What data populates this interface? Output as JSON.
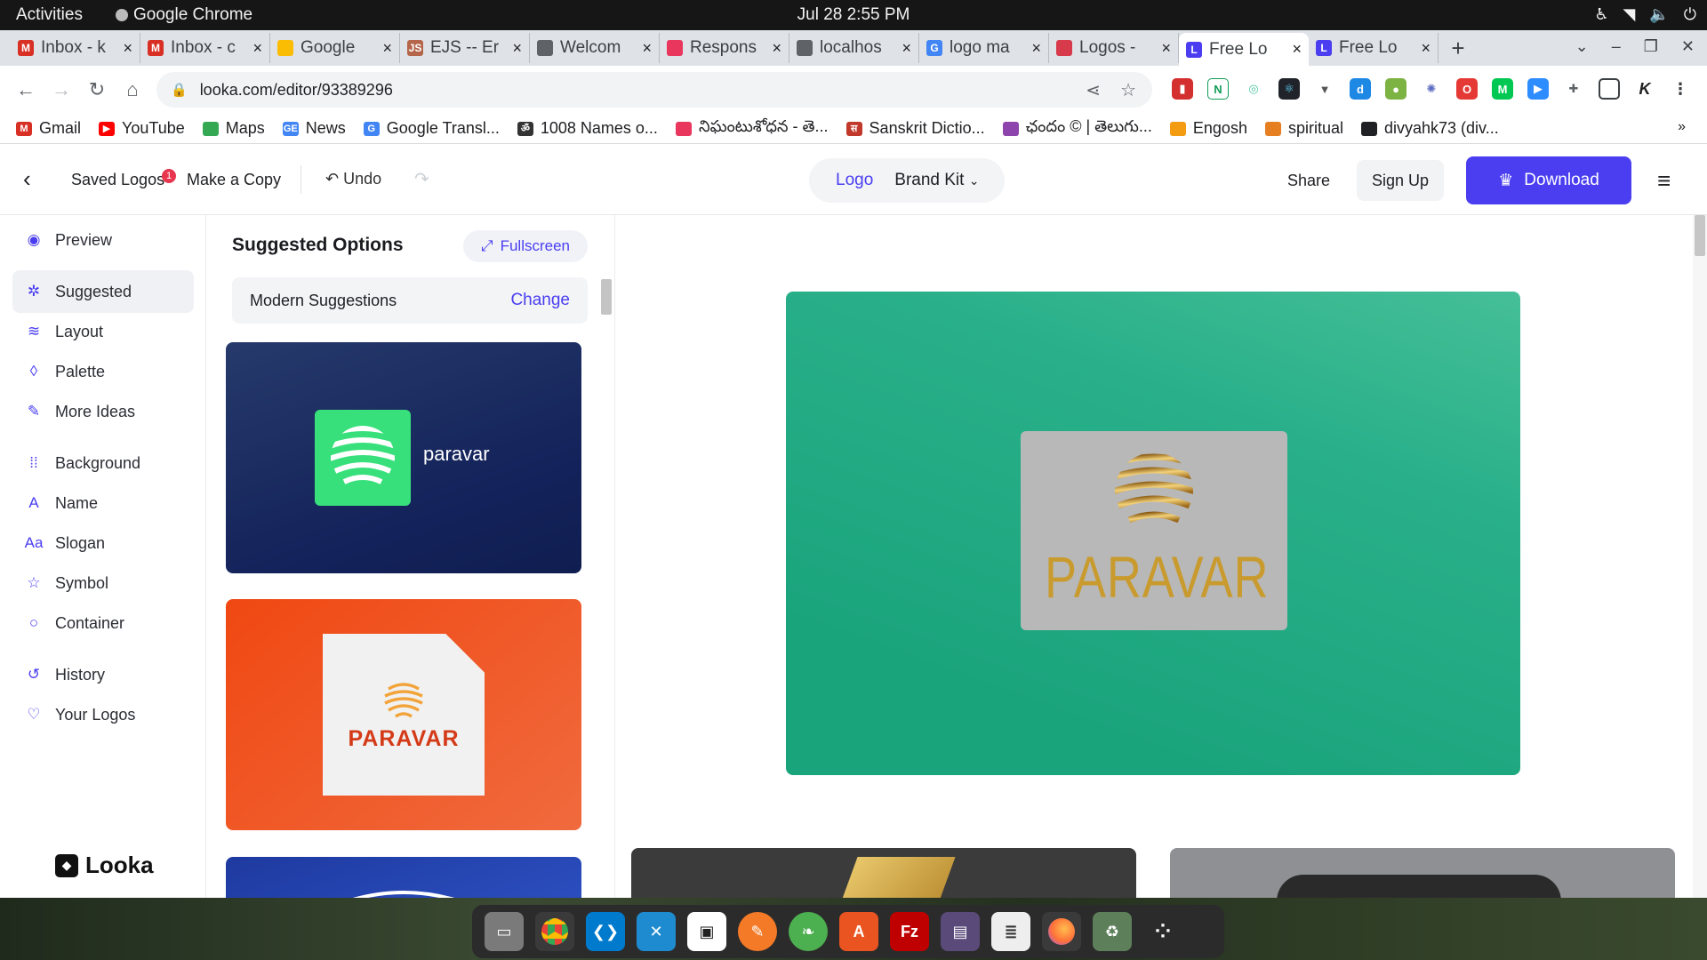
{
  "os_topbar": {
    "activities": "Activities",
    "app_name": "Google Chrome",
    "clock": "Jul 28  2:55 PM"
  },
  "browser_tabs": [
    {
      "title": "Inbox - k",
      "favicon_color": "#d93025",
      "favicon": "M"
    },
    {
      "title": "Inbox - c",
      "favicon_color": "#d93025",
      "favicon": "M"
    },
    {
      "title": "Google",
      "favicon_color": "#fbbc04",
      "favicon": ""
    },
    {
      "title": "EJS -- Er",
      "favicon_color": "#b4654a",
      "favicon": "JS"
    },
    {
      "title": "Welcom",
      "favicon_color": "#5f6368",
      "favicon": ""
    },
    {
      "title": "Respons",
      "favicon_color": "#e8365d",
      "favicon": ""
    },
    {
      "title": "localhos",
      "favicon_color": "#5f6368",
      "favicon": ""
    },
    {
      "title": "logo ma",
      "favicon_color": "#4285f4",
      "favicon": "G"
    },
    {
      "title": "Logos -",
      "favicon_color": "#d73a4a",
      "favicon": ""
    },
    {
      "title": "Free Lo",
      "favicon_color": "#4a3ef0",
      "favicon": "L",
      "active": true
    },
    {
      "title": "Free Lo",
      "favicon_color": "#4a3ef0",
      "favicon": "L"
    }
  ],
  "address_bar": {
    "url": "looka.com/editor/93389296"
  },
  "bookmarks": [
    {
      "label": "Gmail",
      "color": "#d93025",
      "icon": "M"
    },
    {
      "label": "YouTube",
      "color": "#ff0000",
      "icon": "▶"
    },
    {
      "label": "Maps",
      "color": "#34a853",
      "icon": ""
    },
    {
      "label": "News",
      "color": "#4285f4",
      "icon": "GE"
    },
    {
      "label": "Google Transl...",
      "color": "#4285f4",
      "icon": "G"
    },
    {
      "label": "1008 Names o...",
      "color": "#333333",
      "icon": "ॐ"
    },
    {
      "label": "నిఘంటుశోధన - తె...",
      "color": "#e8365d",
      "icon": ""
    },
    {
      "label": "Sanskrit Dictio...",
      "color": "#c0392b",
      "icon": "स"
    },
    {
      "label": "ఛందం © | తెలుగు...",
      "color": "#8e44ad",
      "icon": ""
    },
    {
      "label": "Engosh",
      "color": "#f39c12",
      "icon": ""
    },
    {
      "label": "spiritual",
      "color": "#e67e22",
      "icon": ""
    },
    {
      "label": "divyahk73 (div...",
      "color": "#202124",
      "icon": ""
    }
  ],
  "editor_header": {
    "saved_logos": "Saved Logos",
    "saved_badge": "1",
    "make_copy": "Make a Copy",
    "undo": "Undo",
    "seg_logo": "Logo",
    "seg_brand_kit": "Brand Kit",
    "share": "Share",
    "sign_up": "Sign Up",
    "download": "Download"
  },
  "sidebar": {
    "items": [
      {
        "label": "Preview",
        "icon": "eye-icon",
        "glyph": "◉"
      },
      {
        "label": "Suggested",
        "icon": "lightbulb-icon",
        "glyph": "✲",
        "active": true
      },
      {
        "label": "Layout",
        "icon": "layers-icon",
        "glyph": "≋"
      },
      {
        "label": "Palette",
        "icon": "droplet-icon",
        "glyph": "◊"
      },
      {
        "label": "More Ideas",
        "icon": "wand-icon",
        "glyph": "✎"
      },
      {
        "label": "Background",
        "icon": "background-grid-icon",
        "glyph": "⁞⁞"
      },
      {
        "label": "Name",
        "icon": "text-box-icon",
        "glyph": "A"
      },
      {
        "label": "Slogan",
        "icon": "slogan-text-icon",
        "glyph": "Aa"
      },
      {
        "label": "Symbol",
        "icon": "star-icon",
        "glyph": "☆"
      },
      {
        "label": "Container",
        "icon": "circle-icon",
        "glyph": "○"
      },
      {
        "label": "History",
        "icon": "history-icon",
        "glyph": "↺"
      },
      {
        "label": "Your Logos",
        "icon": "heart-icon",
        "glyph": "♡"
      }
    ],
    "brand": "Looka"
  },
  "suggested_panel": {
    "title": "Suggested Options",
    "fullscreen": "Fullscreen",
    "style_label": "Modern Suggestions",
    "change": "Change",
    "cards": [
      {
        "text": "paravar",
        "bg": "#1b2b5f",
        "mark_color": "#37e07a"
      },
      {
        "text": "PARAVAR",
        "bg": "#f05324",
        "mark_color": "#f2a43a"
      }
    ]
  },
  "preview": {
    "logo_text": "PARAVAR",
    "bg_color": "#23ab84",
    "plate_color": "#b8b8b8",
    "text_color": "#c99b2e"
  }
}
